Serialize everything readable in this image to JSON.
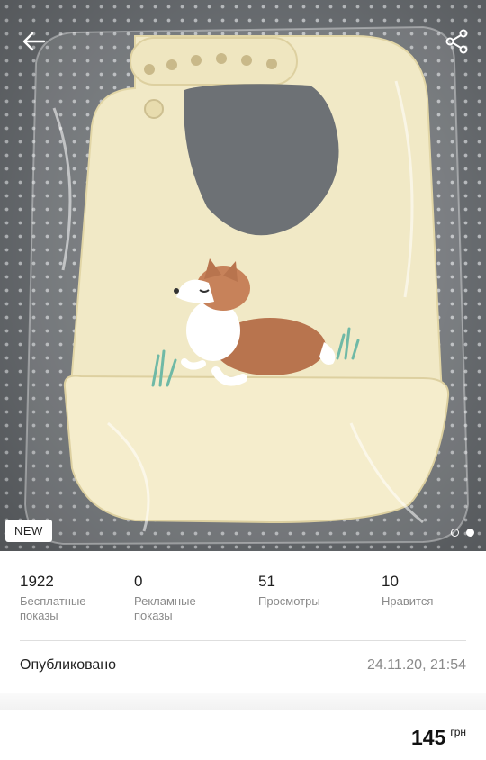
{
  "photo": {
    "badge": "NEW",
    "pages": 2,
    "active_page": 2
  },
  "icons": {
    "back": "arrow-left-icon",
    "share": "share-icon"
  },
  "stats": [
    {
      "value": "1922",
      "label_line1": "Бесплатные",
      "label_line2": "показы"
    },
    {
      "value": "0",
      "label_line1": "Рекламные",
      "label_line2": "показы"
    },
    {
      "value": "51",
      "label_line1": "Просмотры",
      "label_line2": ""
    },
    {
      "value": "10",
      "label_line1": "Нравится",
      "label_line2": ""
    }
  ],
  "published": {
    "label": "Опубликовано",
    "date": "24.11.20, 21:54"
  },
  "price": {
    "value": "145",
    "currency": "грн"
  },
  "colors": {
    "bib": "#f1e9c6",
    "corgi": "#b8744e",
    "grass": "#6fb9a6"
  }
}
